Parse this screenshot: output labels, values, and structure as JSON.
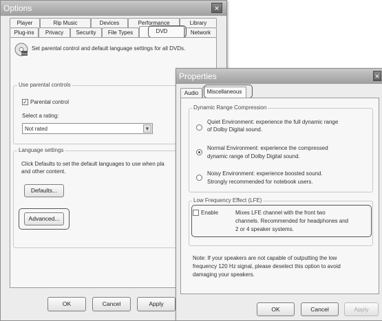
{
  "options": {
    "title": "Options",
    "close": "×",
    "tabs_back": [
      "Player",
      "Rip Music",
      "Devices",
      "Performance",
      "Library"
    ],
    "tabs_front": [
      "Plug-ins",
      "Privacy",
      "Security",
      "File Types",
      "DVD",
      "Network"
    ],
    "header": "Set parental control and default language settings for all DVDs.",
    "parental": {
      "legend": "Use parental controls",
      "checkbox_label": "Parental control",
      "check_mark": "✓",
      "rating_label": "Select a rating:",
      "rating_value": "Not rated",
      "dropdown_icon": "▾"
    },
    "language": {
      "legend": "Language settings",
      "description_line1": "Click Defaults to set the default languages to use when pla",
      "description_line2": "and other content.",
      "defaults_button": "Defaults...",
      "advanced_button": "Advanced..."
    },
    "buttons": {
      "ok": "OK",
      "cancel": "Cancel",
      "apply": "Apply"
    }
  },
  "properties": {
    "title": "Properties",
    "close": "×",
    "tabs": [
      "Audio",
      "Miscellaneous"
    ],
    "drc": {
      "legend": "Dynamic Range Compression",
      "options": [
        {
          "line1": "Quiet Environment: experience the full dynamic range",
          "line2": "of Dolby Digital sound.",
          "selected": false
        },
        {
          "line1": "Normal Environment: experience the compressed",
          "line2": "dynamic range of Dolby Digital sound.",
          "selected": true
        },
        {
          "line1": "Noisy Environment: experience boosted sound.",
          "line2": "Strongly recommended for notebook users.",
          "selected": false
        }
      ]
    },
    "lfe": {
      "legend": "Low Frequency Effect (LFE)",
      "enable_label": "Enable",
      "description_line1": "Mixes LFE channel with the front two",
      "description_line2": "channels. Recommended for headphones and",
      "description_line3": "2 or 4 speaker systems."
    },
    "note_line1": "Note: If your speakers are not capable of outputting the low",
    "note_line2": "frequency 120 Hz signal, please deselect this option to avoid",
    "note_line3": "damaging your speakers.",
    "buttons": {
      "ok": "OK",
      "cancel": "Cancel",
      "apply": "Apply"
    }
  },
  "colors": {
    "titlebar": "#a8a8a8",
    "highlight": "#555555"
  }
}
